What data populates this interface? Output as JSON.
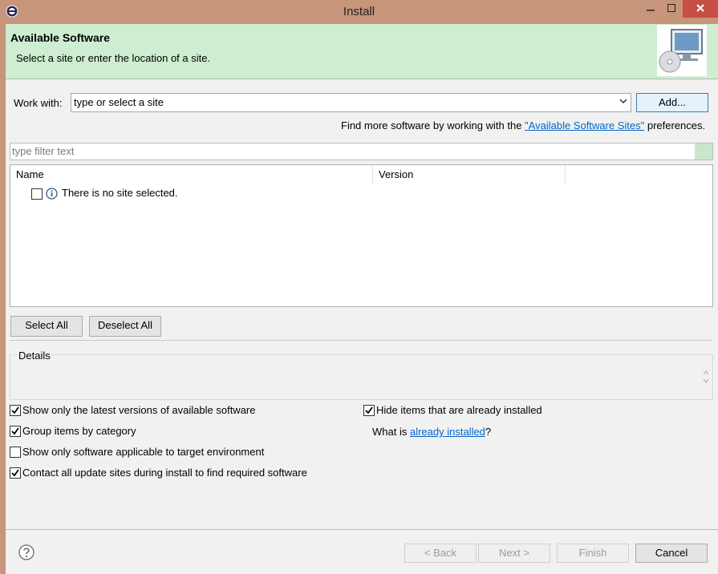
{
  "window": {
    "title": "Install"
  },
  "header": {
    "title": "Available Software",
    "subtitle": "Select a site or enter the location of a site."
  },
  "work_with": {
    "label": "Work with:",
    "value": "type or select a site",
    "add_label": "Add...",
    "more_prefix": "Find more software by working with the ",
    "more_link": "\"Available Software Sites\"",
    "more_suffix": " preferences."
  },
  "filter": {
    "placeholder": "type filter text"
  },
  "table": {
    "columns": [
      "Name",
      "Version"
    ],
    "empty_message": "There is no site selected."
  },
  "buttons": {
    "select_all": "Select All",
    "deselect_all": "Deselect All"
  },
  "details": {
    "label": "Details"
  },
  "options": [
    {
      "label": "Show only the latest versions of available software",
      "checked": true
    },
    {
      "label": "Group items by category",
      "checked": true
    },
    {
      "label": "Show only software applicable to target environment",
      "checked": false
    },
    {
      "label": "Contact all update sites during install to find required software",
      "checked": true
    },
    {
      "label": "Hide items that are already installed",
      "checked": true
    }
  ],
  "already_installed": {
    "prefix": "What is ",
    "link": "already installed",
    "suffix": "?"
  },
  "footer": {
    "back": "< Back",
    "next": "Next >",
    "finish": "Finish",
    "cancel": "Cancel"
  },
  "colors": {
    "header_bg": "#cdeed1",
    "link": "#0066cc",
    "title_bar": "#c6957a"
  }
}
